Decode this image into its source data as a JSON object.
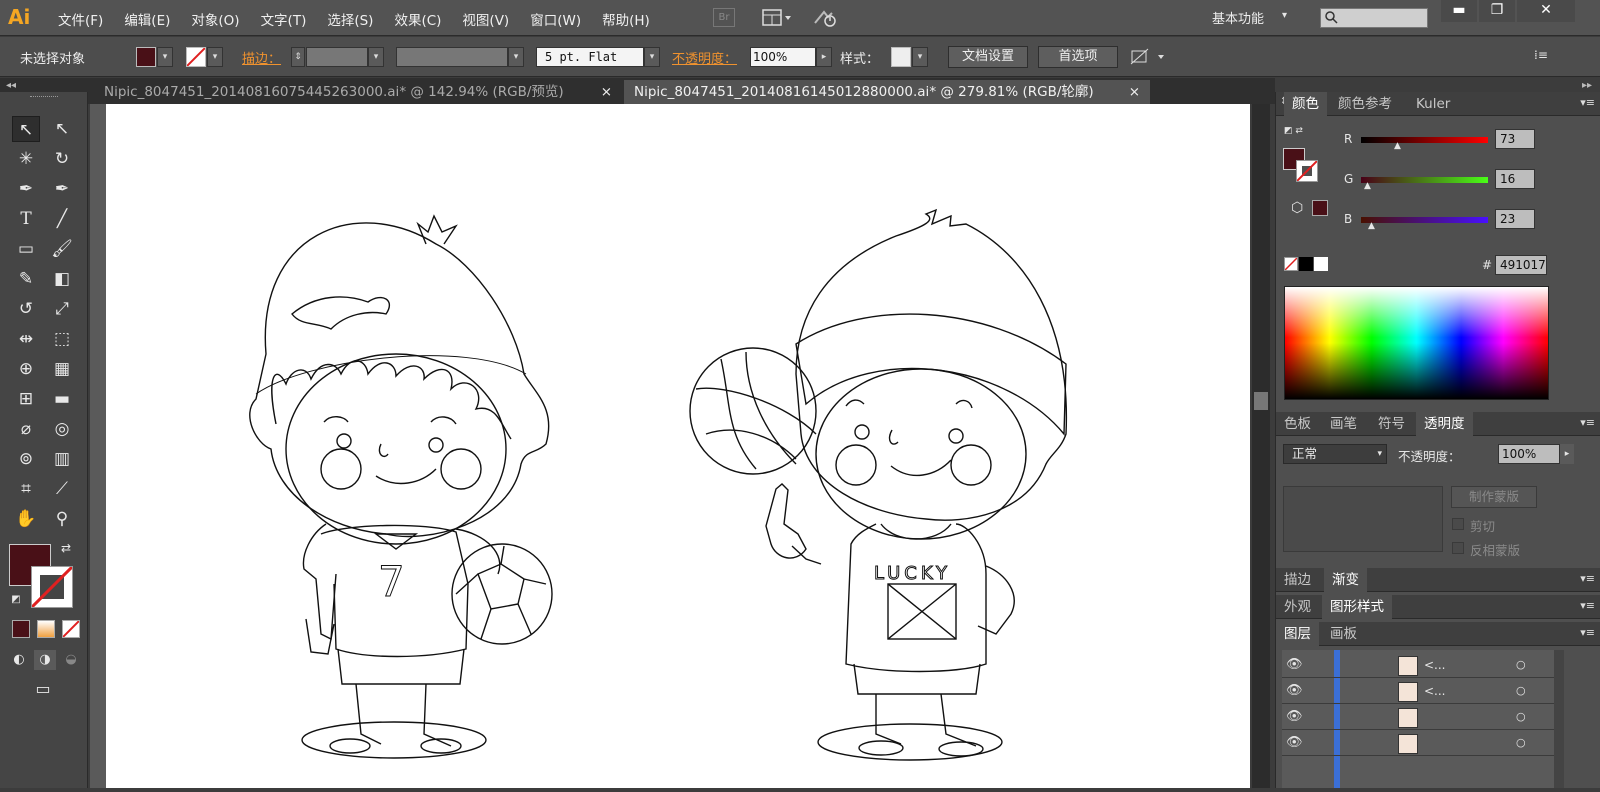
{
  "app": {
    "logo": "Ai",
    "menus": [
      "文件(F)",
      "编辑(E)",
      "对象(O)",
      "文字(T)",
      "选择(S)",
      "效果(C)",
      "视图(V)",
      "窗口(W)",
      "帮助(H)"
    ],
    "bridge_badge": "Br",
    "workspace": "基本功能",
    "window_controls": {
      "minimize": "▬",
      "restore": "❐",
      "close": "✕"
    }
  },
  "control_bar": {
    "selection_label": "未选择对象",
    "stroke_label": "描边：",
    "brush_value": "5 pt. Flat",
    "opacity_label": "不透明度：",
    "opacity_value": "100%",
    "style_label": "样式：",
    "doc_setup_button": "文档设置",
    "prefs_button": "首选项",
    "fill_color": "#491017"
  },
  "doc_tabs": [
    {
      "title": "Nipic_8047451_20140816075445263000.ai* @ 142.94% (RGB/预览)",
      "close": "×",
      "active": false
    },
    {
      "title": "Nipic_8047451_20140816145012880000.ai* @ 279.81% (RGB/轮廓)",
      "close": "×",
      "active": true
    }
  ],
  "color_panel": {
    "tabs": [
      "颜色",
      "颜色参考",
      "Kuler"
    ],
    "r_label": "R",
    "r_value": "73",
    "g_label": "G",
    "g_value": "16",
    "b_label": "B",
    "b_value": "23",
    "hex_label": "#",
    "hex_value": "491017",
    "current_color": "#491017"
  },
  "swatch_panel": {
    "tabs": [
      "色板",
      "画笔",
      "符号",
      "透明度"
    ]
  },
  "transparency_panel": {
    "blend_mode": "正常",
    "opacity_label": "不透明度：",
    "opacity_value": "100%",
    "make_mask_button": "制作蒙版",
    "clip_label": "剪切",
    "invert_label": "反相蒙版"
  },
  "stroke_panel": {
    "tabs": [
      "描边",
      "渐变"
    ]
  },
  "appearance_panel": {
    "tabs": [
      "外观",
      "图形样式"
    ]
  },
  "layers_panel": {
    "tabs": [
      "图层",
      "画板"
    ],
    "rows": [
      {
        "name": "<..."
      },
      {
        "name": "<..."
      },
      {
        "name": ""
      },
      {
        "name": ""
      }
    ]
  },
  "artwork": {
    "left_jersey_number": "7",
    "right_shirt_text": "LUCKY"
  }
}
